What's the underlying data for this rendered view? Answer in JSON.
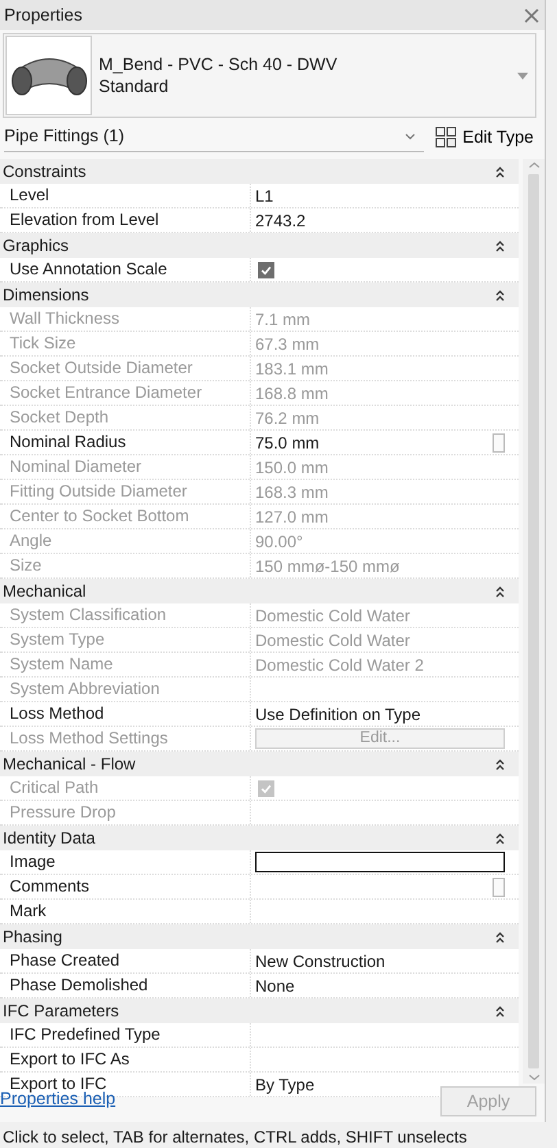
{
  "window": {
    "title": "Properties"
  },
  "type_selector": {
    "family": "M_Bend - PVC - Sch 40 - DWV",
    "type": "Standard"
  },
  "filter": {
    "label": "Pipe Fittings (1)"
  },
  "edit_type_button": {
    "label": "Edit Type"
  },
  "sections": [
    {
      "title": "Constraints",
      "expanded": true,
      "rows": [
        {
          "kind": "text",
          "label": "Level",
          "value": "L1",
          "disabled": false
        },
        {
          "kind": "text",
          "label": "Elevation from Level",
          "value": "2743.2",
          "disabled": false
        }
      ]
    },
    {
      "title": "Graphics",
      "expanded": true,
      "rows": [
        {
          "kind": "checkbox",
          "label": "Use Annotation Scale",
          "checked": true,
          "disabled": false
        }
      ]
    },
    {
      "title": "Dimensions",
      "expanded": true,
      "rows": [
        {
          "kind": "text",
          "label": "Wall Thickness",
          "value": "7.1 mm",
          "disabled": true
        },
        {
          "kind": "text",
          "label": "Tick Size",
          "value": "67.3 mm",
          "disabled": true
        },
        {
          "kind": "text",
          "label": "Socket Outside Diameter",
          "value": "183.1 mm",
          "disabled": true
        },
        {
          "kind": "text",
          "label": "Socket Entrance Diameter",
          "value": "168.8 mm",
          "disabled": true
        },
        {
          "kind": "text",
          "label": "Socket Depth",
          "value": "76.2 mm",
          "disabled": true
        },
        {
          "kind": "text",
          "label": "Nominal Radius",
          "value": "75.0 mm",
          "disabled": false,
          "handle": true
        },
        {
          "kind": "text",
          "label": "Nominal Diameter",
          "value": "150.0 mm",
          "disabled": true
        },
        {
          "kind": "text",
          "label": "Fitting Outside Diameter",
          "value": "168.3 mm",
          "disabled": true
        },
        {
          "kind": "text",
          "label": "Center to Socket Bottom",
          "value": "127.0 mm",
          "disabled": true
        },
        {
          "kind": "text",
          "label": "Angle",
          "value": "90.00°",
          "disabled": true
        },
        {
          "kind": "text",
          "label": "Size",
          "value": "150 mmø-150 mmø",
          "disabled": true
        }
      ]
    },
    {
      "title": "Mechanical",
      "expanded": true,
      "rows": [
        {
          "kind": "text",
          "label": "System Classification",
          "value": "Domestic Cold Water",
          "disabled": true
        },
        {
          "kind": "text",
          "label": "System Type",
          "value": "Domestic Cold Water",
          "disabled": true
        },
        {
          "kind": "text",
          "label": "System Name",
          "value": "Domestic Cold Water 2",
          "disabled": true
        },
        {
          "kind": "text",
          "label": "System Abbreviation",
          "disabled": true
        },
        {
          "kind": "text",
          "label": "Loss Method",
          "value": "Use Definition on Type",
          "disabled": false
        },
        {
          "kind": "button",
          "label": "Loss Method Settings",
          "value": "Edit...",
          "disabled": true
        }
      ]
    },
    {
      "title": "Mechanical - Flow",
      "expanded": true,
      "rows": [
        {
          "kind": "checkbox",
          "label": "Critical Path",
          "checked": true,
          "disabled": true
        },
        {
          "kind": "text",
          "label": "Pressure Drop",
          "disabled": true
        }
      ]
    },
    {
      "title": "Identity Data",
      "expanded": true,
      "rows": [
        {
          "kind": "field",
          "label": "Image",
          "disabled": false
        },
        {
          "kind": "text",
          "label": "Comments",
          "disabled": false,
          "handle": true
        },
        {
          "kind": "text",
          "label": "Mark",
          "disabled": false
        }
      ]
    },
    {
      "title": "Phasing",
      "expanded": true,
      "rows": [
        {
          "kind": "text",
          "label": "Phase Created",
          "value": "New Construction",
          "disabled": false
        },
        {
          "kind": "text",
          "label": "Phase Demolished",
          "value": "None",
          "disabled": false
        }
      ]
    },
    {
      "title": "IFC Parameters",
      "expanded": true,
      "rows": [
        {
          "kind": "text",
          "label": "IFC Predefined Type",
          "disabled": false
        },
        {
          "kind": "text",
          "label": "Export to IFC As",
          "disabled": false
        },
        {
          "kind": "text",
          "label": "Export to IFC",
          "value": "By Type",
          "disabled": false
        }
      ]
    }
  ],
  "help_link": "Properties help",
  "apply_button": {
    "label": "Apply",
    "disabled": true
  },
  "status_bar": "Click to select, TAB for alternates, CTRL adds, SHIFT unselects"
}
